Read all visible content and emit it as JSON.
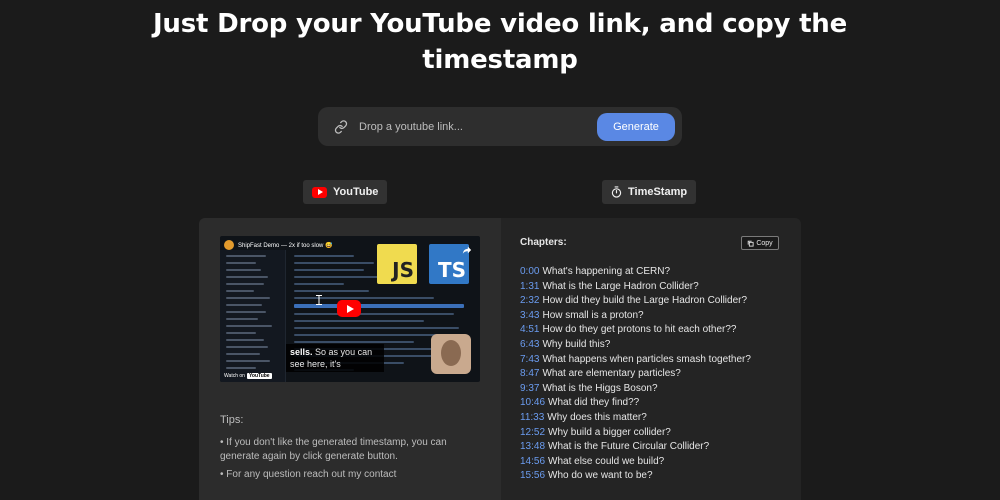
{
  "hero": {
    "title_line1": "Just Drop your YouTube video link, and copy the",
    "title_line2": "timestamp"
  },
  "search": {
    "placeholder": "Drop a youtube link...",
    "value": "",
    "button_label": "Generate"
  },
  "tabs": {
    "youtube_label": "YouTube",
    "timestamp_label": "TimeStamp"
  },
  "video": {
    "title": "ShipFast Demo — 2x if too slow 😅",
    "js_logo": "JS",
    "ts_logo": "TS",
    "caption_bold": "sells.",
    "caption_rest": "So as you can see here, it's",
    "watch_on": "Watch on",
    "watch_on_brand": "YouTube"
  },
  "tips": {
    "label": "Tips:",
    "items": [
      "• If you don't like the generated timestamp, you can generate again by click generate button.",
      "• For any question reach out my contact"
    ]
  },
  "chapters": {
    "label": "Chapters:",
    "copy_label": "Copy",
    "items": [
      {
        "time": "0:00",
        "title": "What's happening at CERN?"
      },
      {
        "time": "1:31",
        "title": "What is the Large Hadron Collider?"
      },
      {
        "time": "2:32",
        "title": "How did they build the Large Hadron Collider?"
      },
      {
        "time": "3:43",
        "title": "How small is a proton?"
      },
      {
        "time": "4:51",
        "title": "How do they get protons to hit each other??"
      },
      {
        "time": "6:43",
        "title": "Why build this?"
      },
      {
        "time": "7:43",
        "title": "What happens when particles smash together?"
      },
      {
        "time": "8:47",
        "title": "What are elementary particles?"
      },
      {
        "time": "9:37",
        "title": "What is the Higgs Boson?"
      },
      {
        "time": "10:46",
        "title": "What did they find??"
      },
      {
        "time": "11:33",
        "title": "Why does this matter?"
      },
      {
        "time": "12:52",
        "title": "Why build a bigger collider?"
      },
      {
        "time": "13:48",
        "title": "What is the Future Circular Collider?"
      },
      {
        "time": "14:56",
        "title": "What else could we build?"
      },
      {
        "time": "15:56",
        "title": "Who do we want to be?"
      }
    ]
  },
  "colors": {
    "background": "#1b1b1b",
    "accent": "#5a88e4",
    "timestamp_link": "#6b9cf0",
    "youtube_red": "#ff0000"
  },
  "icons": {
    "search": "link-icon",
    "youtube_tab": "youtube-icon",
    "timestamp_tab": "stopwatch-icon",
    "copy": "copy-icon"
  }
}
